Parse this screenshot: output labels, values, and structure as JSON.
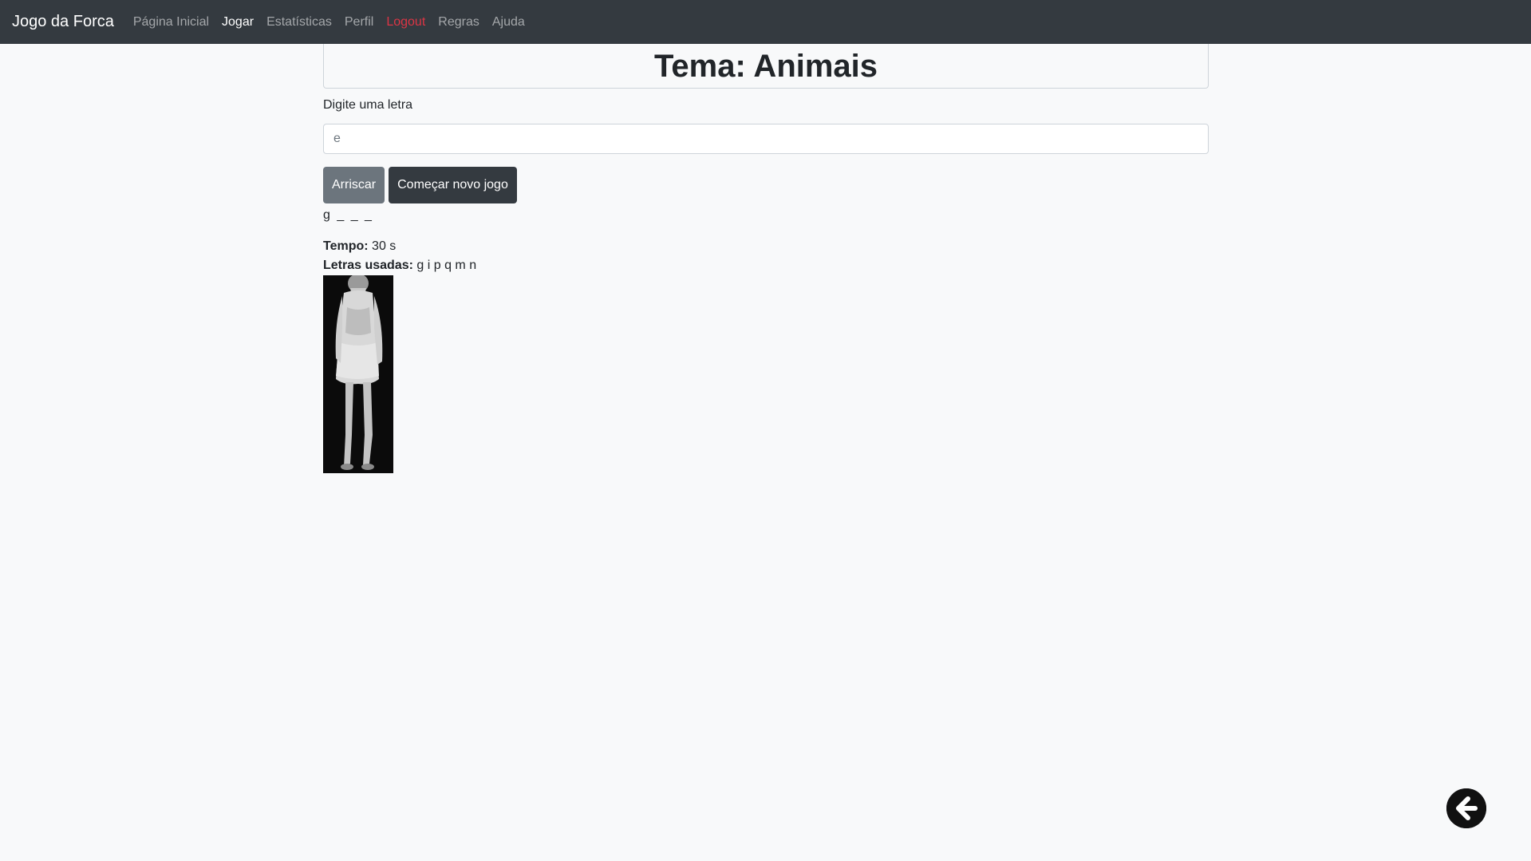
{
  "navbar": {
    "brand": "Jogo da Forca",
    "items": [
      {
        "label": "Página Inicial"
      },
      {
        "label": "Jogar"
      },
      {
        "label": "Estatísticas"
      },
      {
        "label": "Perfil"
      },
      {
        "label": "Logout"
      },
      {
        "label": "Regras"
      },
      {
        "label": "Ajuda"
      }
    ],
    "active_item": "Jogar"
  },
  "game": {
    "theme_title": "Tema: Animais",
    "input_label": "Digite uma letra",
    "input_placeholder": "e",
    "guess_button": "Arriscar",
    "new_game_button": "Começar novo jogo",
    "word_display": "g _ _ _",
    "time_label": "Tempo:",
    "time_value": "30 s",
    "used_letters_label": "Letras usadas:",
    "used_letters_value": "g i p q m n"
  },
  "icons": {
    "back": "arrow-left-circle-icon"
  },
  "colors": {
    "navbar_bg": "#343a40",
    "page_bg": "#f8f9fa",
    "logout": "#dc3545",
    "btn_secondary": "#6c757d",
    "btn_dark": "#343a40"
  }
}
